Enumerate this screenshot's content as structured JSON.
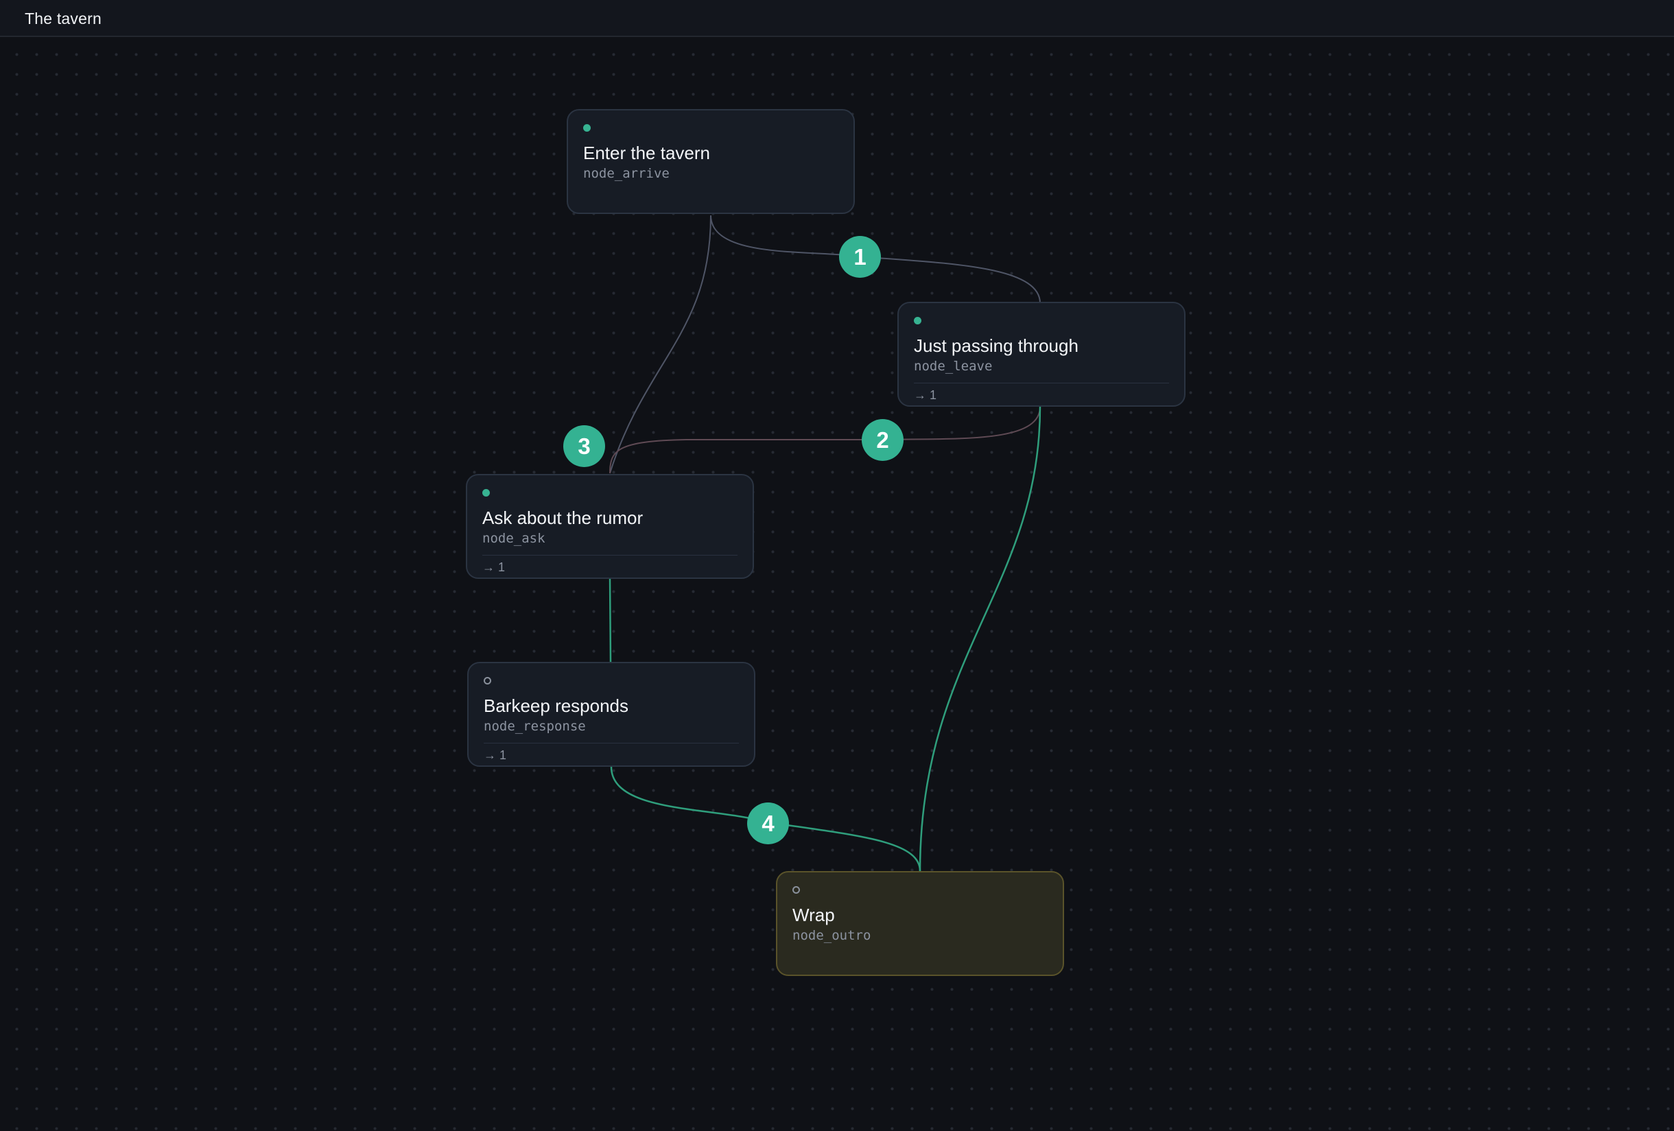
{
  "header": {
    "title": "The tavern"
  },
  "colors": {
    "accent": "#34b292",
    "edge_default": "#4f5566",
    "edge_selected": "#2f9e7c",
    "edge_highlight": "#5f4a54",
    "end_node_border": "#5a532a"
  },
  "nodes": [
    {
      "title": "Enter the tavern",
      "id": "node_arrive",
      "status": "active",
      "footer": ""
    },
    {
      "title": "Just passing through",
      "id": "node_leave",
      "status": "active",
      "footer": "→ 1"
    },
    {
      "title": "Ask about the rumor",
      "id": "node_ask",
      "status": "active",
      "footer": "→ 1"
    },
    {
      "title": "Barkeep responds",
      "id": "node_response",
      "status": "inactive",
      "footer": "→ 1"
    },
    {
      "title": "Wrap",
      "id": "node_outro",
      "status": "inactive",
      "footer": ""
    }
  ],
  "edge_badges": [
    "1",
    "2",
    "3",
    "4"
  ]
}
